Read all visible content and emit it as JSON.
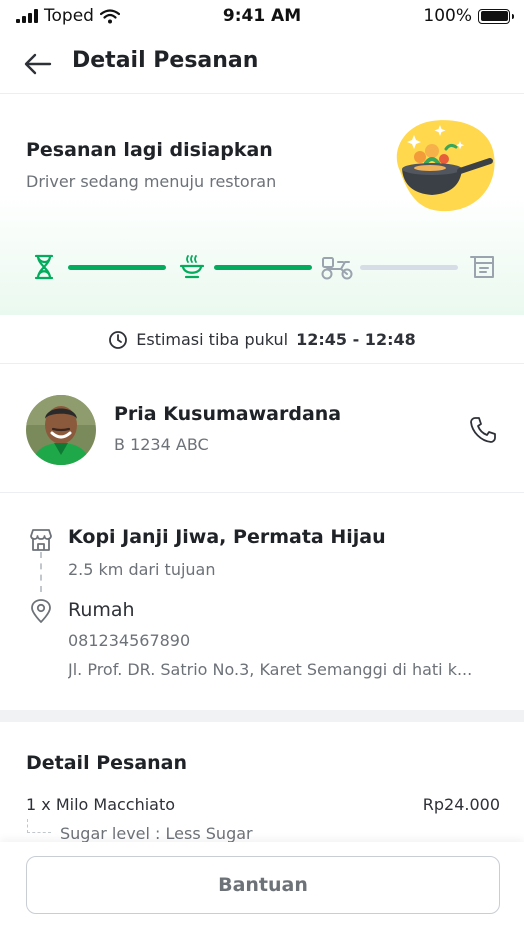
{
  "status_bar": {
    "carrier": "Toped",
    "time": "9:41 AM",
    "battery": "100%",
    "battery_level": 1.0
  },
  "header": {
    "title": "Detail Pesanan"
  },
  "order_status": {
    "title": "Pesanan lagi disiapkan",
    "subtitle": "Driver sedang menuju restoran",
    "progress_steps": [
      "hourglass-icon",
      "cooking-pot-icon",
      "motorbike-icon",
      "delivered-box-icon"
    ],
    "completed_segments": 2,
    "total_segments": 3,
    "active_color": "#03ac5d",
    "inactive_color": "#d6dde6"
  },
  "eta": {
    "label": "Estimasi tiba pukul",
    "time_range": "12:45 - 12:48"
  },
  "driver": {
    "name": "Pria Kusumawardana",
    "plate": "B 1234 ABC"
  },
  "route": {
    "restaurant_name": "Kopi Janji Jiwa, Permata Hijau",
    "restaurant_distance": "2.5 km dari tujuan",
    "destination_name": "Rumah",
    "destination_phone": "081234567890",
    "destination_address": "Jl. Prof. DR. Satrio No.3, Karet Semanggi di hati k..."
  },
  "order_detail": {
    "title": "Detail Pesanan",
    "items": [
      {
        "name": "1 x Milo Macchiato",
        "price": "Rp24.000",
        "note": "Sugar level : Less Sugar"
      }
    ]
  },
  "footer": {
    "help_label": "Bantuan"
  }
}
